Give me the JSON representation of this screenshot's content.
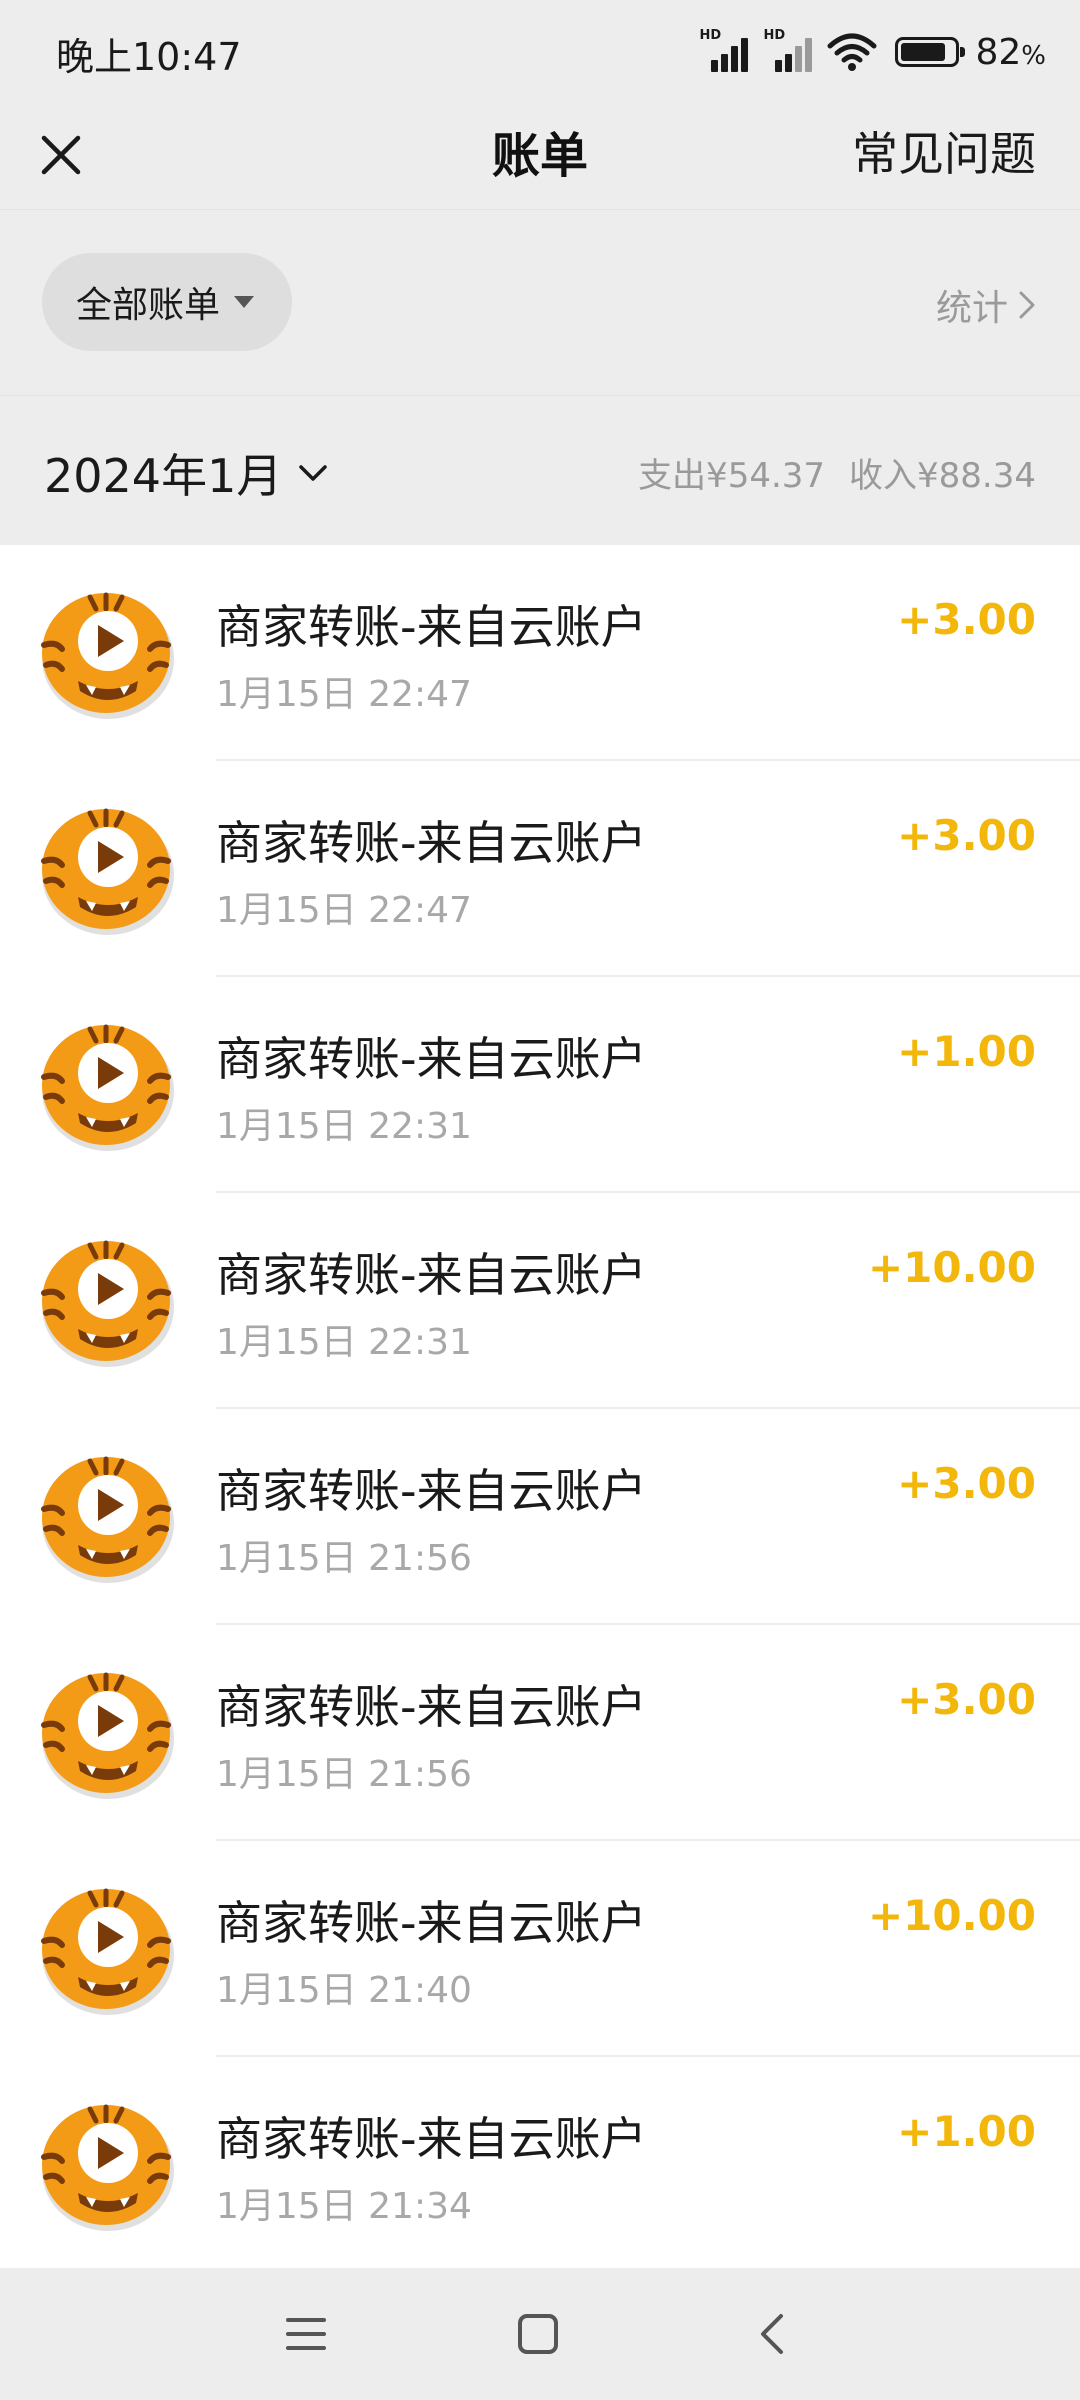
{
  "status_bar": {
    "time": "晚上10:47",
    "signal_tag": "HD",
    "battery_value": "82",
    "battery_unit": "%"
  },
  "nav": {
    "title": "账单",
    "faq_label": "常见问题"
  },
  "filter": {
    "label": "全部账单",
    "stats_label": "统计"
  },
  "month": {
    "label": "2024年1月",
    "expense": "支出¥54.37",
    "income": "收入¥88.34"
  },
  "transactions": [
    {
      "title": "商家转账-来自云账户",
      "time": "1月15日 22:47",
      "amount": "+3.00"
    },
    {
      "title": "商家转账-来自云账户",
      "time": "1月15日 22:47",
      "amount": "+3.00"
    },
    {
      "title": "商家转账-来自云账户",
      "time": "1月15日 22:31",
      "amount": "+1.00"
    },
    {
      "title": "商家转账-来自云账户",
      "time": "1月15日 22:31",
      "amount": "+10.00"
    },
    {
      "title": "商家转账-来自云账户",
      "time": "1月15日 21:56",
      "amount": "+3.00"
    },
    {
      "title": "商家转账-来自云账户",
      "time": "1月15日 21:56",
      "amount": "+3.00"
    },
    {
      "title": "商家转账-来自云账户",
      "time": "1月15日 21:40",
      "amount": "+10.00"
    },
    {
      "title": "商家转账-来自云账户",
      "time": "1月15日 21:34",
      "amount": "+1.00"
    }
  ],
  "icons": {
    "avatar": "tiger-play-avatar-icon",
    "close": "close-icon",
    "menu": "menu-icon",
    "home": "home-icon",
    "back": "back-icon"
  },
  "colors": {
    "amount": "#f2b70a",
    "avatar_orange": "#f39a16",
    "background": "#ededed"
  }
}
